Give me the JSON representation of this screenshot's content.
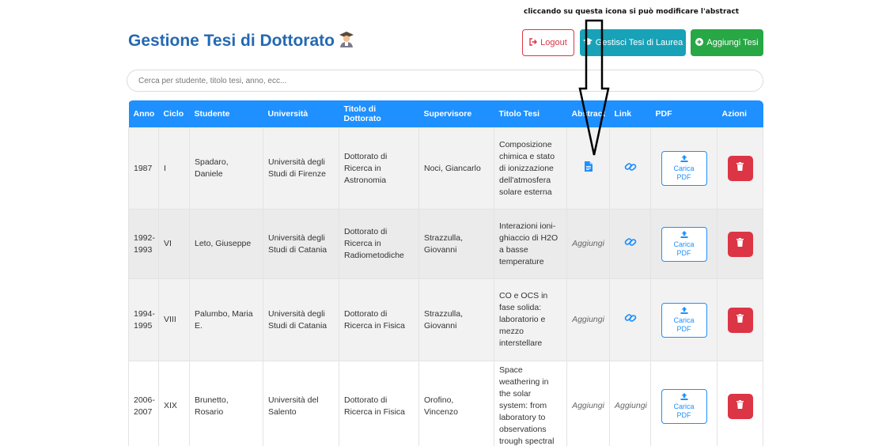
{
  "annotation": "cliccando su questa icona si può modificare l'abstract",
  "header": {
    "title": "Gestione Tesi di Dottorato",
    "logout_label": "Logout",
    "manage_label": "Gestisci Tesi di Laurea",
    "add_label": "Aggiungi Tesi"
  },
  "search": {
    "placeholder": "Cerca per studente, titolo tesi, anno, ecc..."
  },
  "columns": [
    "Anno",
    "Ciclo",
    "Studente",
    "Università",
    "Titolo di Dottorato",
    "Supervisore",
    "Titolo Tesi",
    "Abstract",
    "Link",
    "PDF",
    "Azioni"
  ],
  "upload_label_top": "Carica",
  "upload_label_bottom": "PDF",
  "rows": [
    {
      "anno": "1987",
      "ciclo": "I",
      "studente": "Spadaro, Daniele",
      "universita": "Università degli Studi di Firenze",
      "titolo_dottorato": "Dottorato di Ricerca in Astronomia",
      "supervisore": "Noci, Giancarlo",
      "titolo_tesi": "Composizione chimica e stato di ionizzazione dell'atmosfera solare esterna",
      "abstract": "",
      "link": ""
    },
    {
      "anno": "1992-1993",
      "ciclo": "VI",
      "studente": "Leto, Giuseppe",
      "universita": "Università degli Studi di Catania",
      "titolo_dottorato": "Dottorato di Ricerca in Radiometodiche",
      "supervisore": "Strazzulla, Giovanni",
      "titolo_tesi": "Interazioni ioni-ghiaccio di H2O a basse temperature",
      "abstract": "Aggiungi",
      "link": ""
    },
    {
      "anno": "1994-1995",
      "ciclo": "VIII",
      "studente": "Palumbo, Maria E.",
      "universita": "Università degli Studi di Catania",
      "titolo_dottorato": "Dottorato di Ricerca in Fisica",
      "supervisore": "Strazzulla, Giovanni",
      "titolo_tesi": "CO e OCS in fase solida: laboratorio e mezzo interstellare",
      "abstract": "Aggiungi",
      "link": ""
    },
    {
      "anno": "2006-2007",
      "ciclo": "XIX",
      "studente": "Brunetto, Rosario",
      "universita": "Università del Salento",
      "titolo_dottorato": "Dottorato di Ricerca in Fisica",
      "supervisore": "Orofino, Vincenzo",
      "titolo_tesi": "Space weathering in the solar system: from laboratory to observations trough spectral",
      "abstract": "Aggiungi",
      "link": "Aggiungi"
    }
  ],
  "colors": {
    "primary": "#1e90ff",
    "title": "#2469b3",
    "danger": "#dc3545",
    "info": "#17a2b8",
    "success": "#28a745"
  }
}
